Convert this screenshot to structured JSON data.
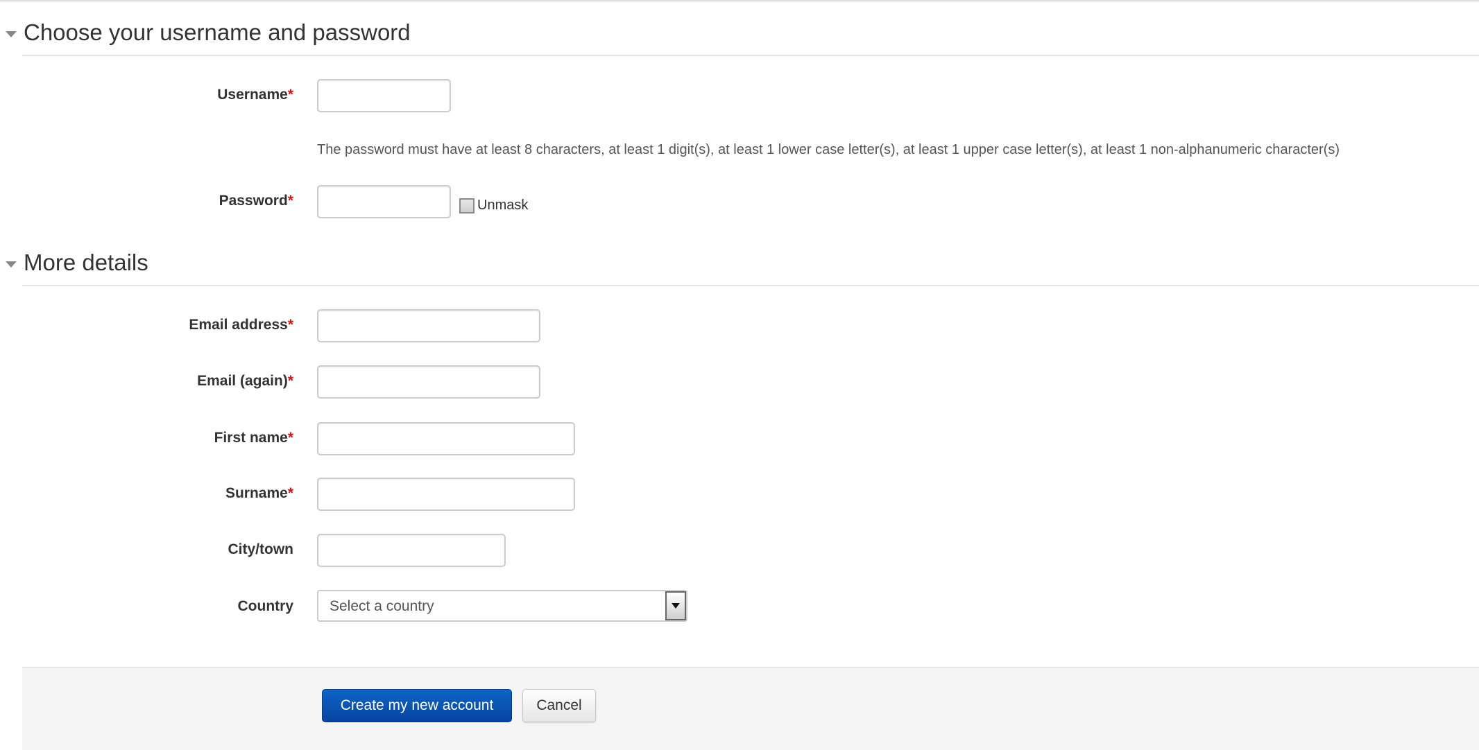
{
  "sections": {
    "account": {
      "title": "Choose your username and password"
    },
    "details": {
      "title": "More details"
    }
  },
  "fields": {
    "username": {
      "label": "Username",
      "required": "*",
      "value": ""
    },
    "password_policy": "The password must have at least 8 characters, at least 1 digit(s), at least 1 lower case letter(s), at least 1 upper case letter(s), at least 1 non-alphanumeric character(s)",
    "password": {
      "label": "Password",
      "required": "*",
      "value": "",
      "unmask_label": "Unmask"
    },
    "email": {
      "label": "Email address",
      "required": "*",
      "value": ""
    },
    "email2": {
      "label": "Email (again)",
      "required": "*",
      "value": ""
    },
    "firstname": {
      "label": "First name",
      "required": "*",
      "value": ""
    },
    "surname": {
      "label": "Surname",
      "required": "*",
      "value": ""
    },
    "city": {
      "label": "City/town",
      "value": ""
    },
    "country": {
      "label": "Country",
      "selected": "Select a country"
    }
  },
  "actions": {
    "submit_label": "Create my new account",
    "cancel_label": "Cancel"
  },
  "colors": {
    "primary": "#0a55b5",
    "required": "#dd1111",
    "footer_bg": "#f5f5f5"
  }
}
